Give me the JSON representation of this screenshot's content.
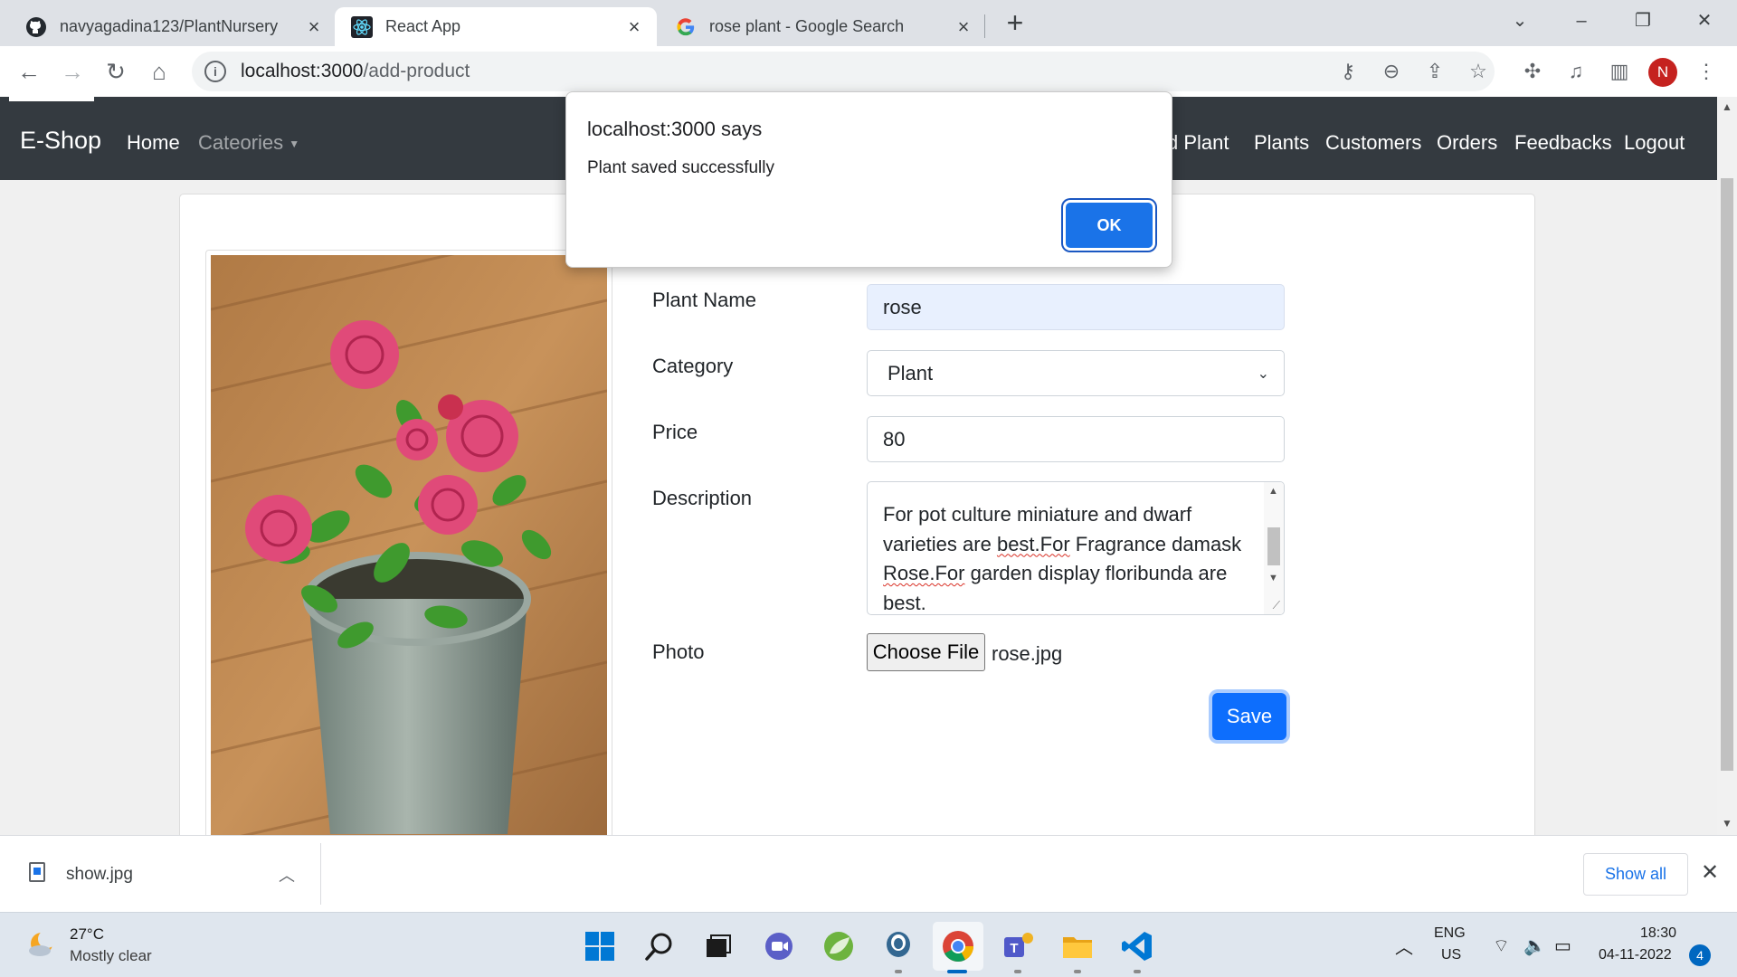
{
  "browser": {
    "tabs": [
      {
        "title": "navyagadina123/PlantNursery",
        "icon": "github-icon"
      },
      {
        "title": "React App",
        "icon": "react-icon"
      },
      {
        "title": "rose plant - Google Search",
        "icon": "google-icon"
      }
    ],
    "active_tab_index": 1,
    "url_host": "localhost:3000",
    "url_path": "/add-product",
    "profile_initial": "N"
  },
  "app": {
    "brand": "E-Shop",
    "nav": {
      "home": "Home",
      "categories": "Cateories",
      "add_plant_partial": "d Plant",
      "plants": "Plants",
      "customers": "Customers",
      "orders": "Orders",
      "feedbacks": "Feedbacks",
      "logout": "Logout"
    }
  },
  "form": {
    "plant_name_label": "Plant Name",
    "plant_name_value": "rose",
    "category_label": "Category",
    "category_value": "Plant",
    "price_label": "Price",
    "price_value": "80",
    "description_label": "Description",
    "description_value": [
      "For pot culture miniature and dwarf",
      "varieties are ",
      "best.For",
      " Fragrance damask",
      "Rose.For",
      " garden display floribunda are",
      "best."
    ],
    "photo_label": "Photo",
    "choose_file_label": "Choose File",
    "file_name": "rose.jpg",
    "save_label": "Save"
  },
  "dialog": {
    "title": "localhost:3000 says",
    "message": "Plant saved successfully",
    "ok_label": "OK"
  },
  "download_shelf": {
    "file_name": "show.jpg",
    "show_all_label": "Show all"
  },
  "taskbar": {
    "temperature": "27°C",
    "weather": "Mostly clear",
    "language": "ENG",
    "region": "US",
    "time": "18:30",
    "date": "04-11-2022",
    "notification_count": "4"
  },
  "colors": {
    "navbar": "#343a40",
    "primary": "#0d6efd",
    "dialog_button": "#1a73e8",
    "autofill": "#e8f0fe"
  }
}
